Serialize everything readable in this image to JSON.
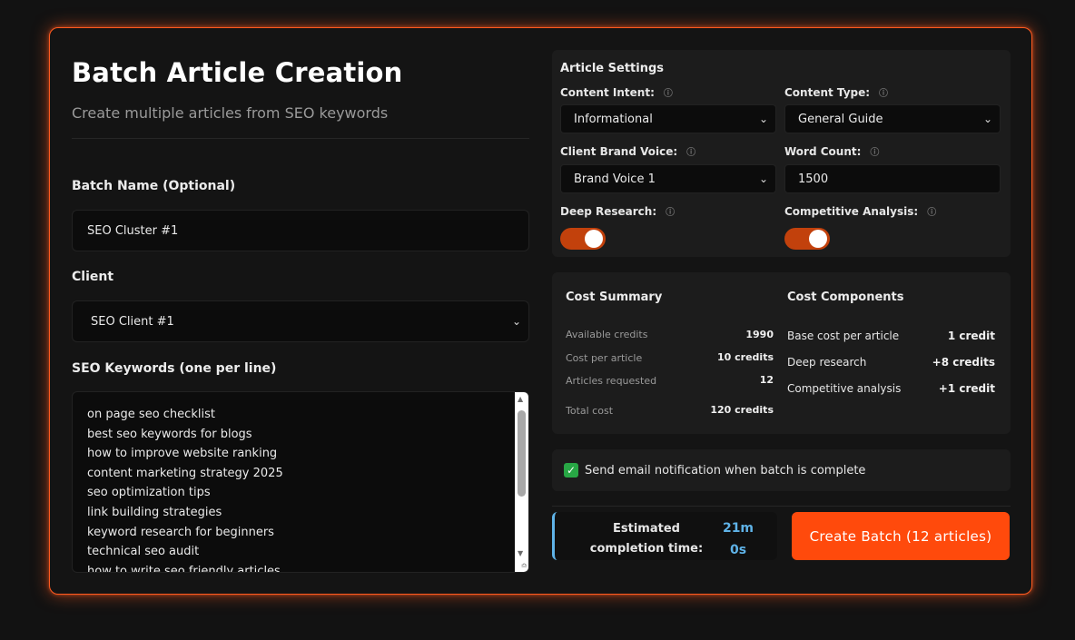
{
  "header": {
    "title": "Batch Article Creation",
    "subtitle": "Create multiple articles from SEO keywords"
  },
  "form": {
    "batch_name_label": "Batch Name (Optional)",
    "batch_name_value": "SEO Cluster #1",
    "client_label": "Client",
    "client_value": "SEO Client #1",
    "keywords_label": "SEO Keywords (one per line)",
    "keywords": [
      "on page seo checklist",
      "best seo keywords for blogs",
      "how to improve website ranking",
      "content marketing strategy 2025",
      "seo optimization tips",
      "link building strategies",
      "keyword research for beginners",
      "technical seo audit",
      "how to write seo friendly articles"
    ]
  },
  "settings": {
    "title": "Article Settings",
    "content_intent_label": "Content Intent:",
    "content_intent_value": "Informational",
    "content_type_label": "Content Type:",
    "content_type_value": "General Guide",
    "brand_voice_label": "Client Brand Voice:",
    "brand_voice_value": "Brand Voice 1",
    "word_count_label": "Word Count:",
    "word_count_value": "1500",
    "deep_research_label": "Deep Research:",
    "deep_research_on": true,
    "competitive_label": "Competitive Analysis:",
    "competitive_on": true
  },
  "cost_summary": {
    "title": "Cost Summary",
    "rows": [
      {
        "label": "Available credits",
        "value": "1990"
      },
      {
        "label": "Cost per article",
        "value": "10 credits"
      },
      {
        "label": "Articles requested",
        "value": "12"
      },
      {
        "label": "Total cost",
        "value": "120 credits"
      }
    ]
  },
  "cost_components": {
    "title": "Cost Components",
    "rows": [
      {
        "label": "Base cost per article",
        "value": "1 credit"
      },
      {
        "label": "Deep research",
        "value": "+8 credits"
      },
      {
        "label": "Competitive analysis",
        "value": "+1 credit"
      }
    ]
  },
  "notification": {
    "checked": true,
    "label": "Send email notification when batch is complete"
  },
  "estimate": {
    "label": "Estimated completion time:",
    "minutes": "21m",
    "seconds": "0s"
  },
  "create_button_label": "Create Batch (12 articles)",
  "icons": {
    "info": "info-circle-icon",
    "chevron": "chevron-down-icon",
    "check": "check-icon"
  },
  "colors": {
    "accent": "#ff4a0c",
    "toggle": "#c2410c",
    "estimate": "#5fb3e8",
    "checkbox": "#28a745"
  }
}
